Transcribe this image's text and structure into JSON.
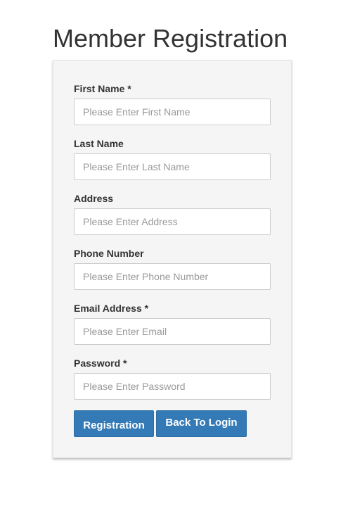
{
  "page": {
    "title": "Member Registration"
  },
  "form": {
    "fields": [
      {
        "label": "First Name *",
        "placeholder": "Please Enter First Name",
        "value": ""
      },
      {
        "label": "Last Name",
        "placeholder": "Please Enter Last Name",
        "value": ""
      },
      {
        "label": "Address",
        "placeholder": "Please Enter Address",
        "value": ""
      },
      {
        "label": "Phone Number",
        "placeholder": "Please Enter Phone Number",
        "value": ""
      },
      {
        "label": "Email Address *",
        "placeholder": "Please Enter Email",
        "value": ""
      },
      {
        "label": "Password *",
        "placeholder": "Please Enter Password",
        "value": ""
      }
    ],
    "buttons": {
      "register_label": "Registration",
      "back_label": "Back To Login"
    }
  },
  "colors": {
    "button_primary": "#337ab7",
    "panel_background": "#f5f5f5",
    "title_text": "#333333"
  }
}
